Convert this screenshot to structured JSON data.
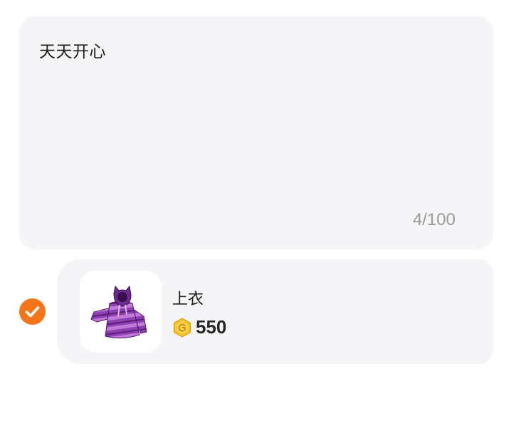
{
  "message": {
    "text": "天天开心",
    "counter": "4/100"
  },
  "item": {
    "selected": true,
    "name": "上衣",
    "price": "550",
    "thumbnail_icon": "hoodie-icon",
    "currency_icon": "coin-icon"
  },
  "colors": {
    "card_background": "#f5f5f8",
    "accent": "#f5751a",
    "coin": "#f6c12b"
  }
}
